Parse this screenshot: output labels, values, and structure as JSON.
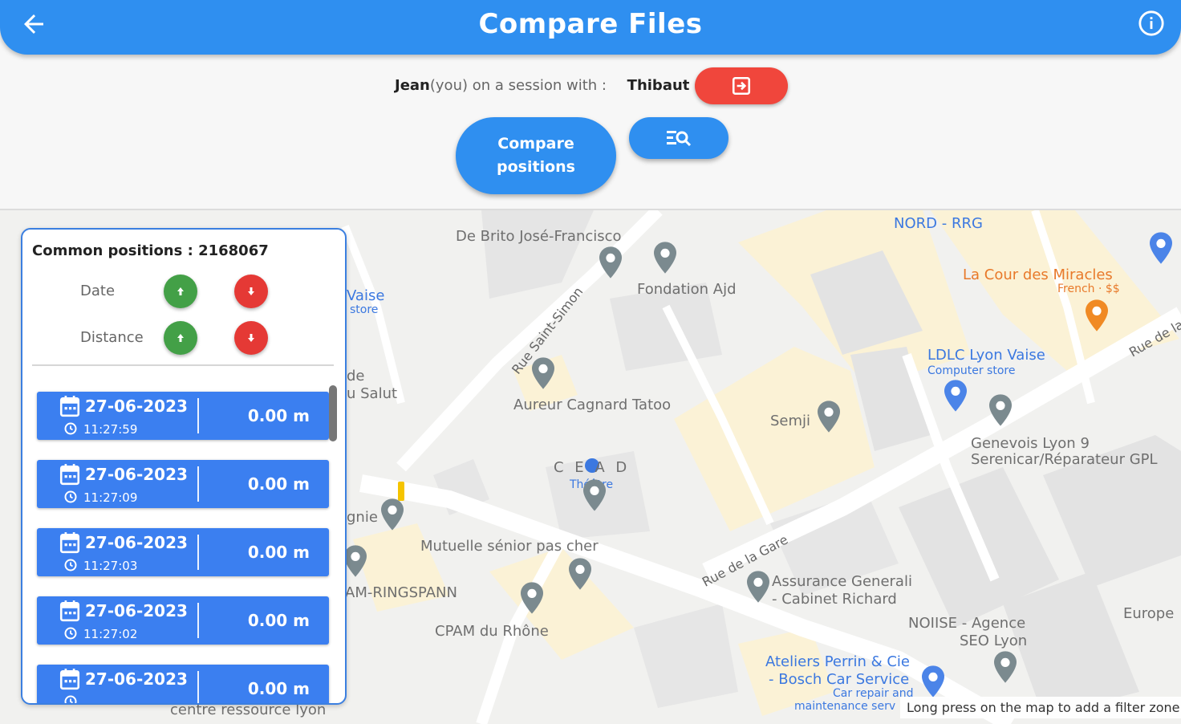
{
  "header": {
    "title": "Compare Files",
    "back_icon": "arrow-left-icon",
    "info_icon": "info-icon"
  },
  "session": {
    "user": "Jean",
    "you_label": "(you)",
    "text": " on a session with : ",
    "partner": "Thibaut",
    "leave_icon": "exit-session-icon"
  },
  "actions": {
    "compare_label": "Compare positions",
    "filter_icon": "filter-search-icon"
  },
  "panel": {
    "count_label": "Common positions : 2168067",
    "sort_date": "Date",
    "sort_distance": "Distance",
    "rows": [
      {
        "date": "27-06-2023",
        "time": "11:27:59",
        "distance": "0.00 m"
      },
      {
        "date": "27-06-2023",
        "time": "11:27:09",
        "distance": "0.00 m"
      },
      {
        "date": "27-06-2023",
        "time": "11:27:03",
        "distance": "0.00 m"
      },
      {
        "date": "27-06-2023",
        "time": "11:27:02",
        "distance": "0.00 m"
      },
      {
        "date": "27-06-2023",
        "time": "",
        "distance": "0.00 m"
      }
    ]
  },
  "map": {
    "labels": {
      "debrito": "De Brito José-Francisco",
      "fondation": "Fondation Ajd",
      "nord_rrg": "NORD - RRG",
      "cour_miracles": "La Cour des Miracles",
      "cour_sub": "French · $$",
      "ldlc": "LDLC Lyon Vaise",
      "ldlc_sub": "Computer store",
      "aureur": "Aureur Cagnard Tatoo",
      "semji": "Semji",
      "genevois": "Genevois Lyon 9",
      "serenicar": "Serenicar/Réparateur GPL",
      "cead": "C E A D",
      "theatre": "Théâtre",
      "mutuelle": "Mutuelle sénior pas cher",
      "ringspann": "AM-RINGSPANN",
      "cpam": "CPAM du Rhône",
      "assurance1": "Assurance Generali",
      "assurance2": "- Cabinet Richard",
      "noiise1": "NOIISE - Agence",
      "noiise2": "SEO Lyon",
      "europe": "Europe",
      "ateliers1": "Ateliers Perrin & Cie",
      "ateliers2": "- Bosch Car Service",
      "ateliers3": "Car repair and",
      "ateliers4": "maintenance serv",
      "centre": "centre ressource lyon",
      "vaise1": "Vaise",
      "vaise2": "store",
      "desalut1": "de",
      "desalut2": "u Salut",
      "gnie": "gnie",
      "street_saint_simon": "Rue Saint-Simon",
      "street_gare": "Rue de la Gare",
      "street_rue_de_la": "Rue de la"
    },
    "hint": "Long press on the map to add a filter zone"
  }
}
